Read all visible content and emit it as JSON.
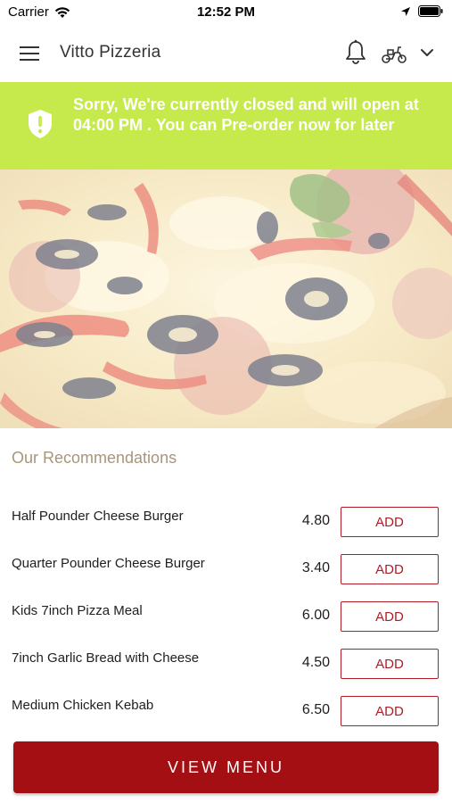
{
  "status_bar": {
    "carrier": "Carrier",
    "time": "12:52 PM"
  },
  "header": {
    "title": "Vitto Pizzeria"
  },
  "banner": {
    "message": "Sorry, We're currently closed and will open at 04:00 PM . You can Pre-order now for later",
    "color": "#c6ea4b"
  },
  "recommendations": {
    "title": "Our Recommendations",
    "add_label": "ADD",
    "items": [
      {
        "name": "Half Pounder Cheese Burger",
        "price": "4.80"
      },
      {
        "name": "Quarter Pounder Cheese Burger",
        "price": "3.40"
      },
      {
        "name": "Kids 7inch Pizza Meal",
        "price": "6.00"
      },
      {
        "name": "7inch Garlic Bread with Cheese",
        "price": "4.50"
      },
      {
        "name": "Medium Chicken Kebab",
        "price": "6.50"
      }
    ]
  },
  "footer": {
    "view_menu_label": "VIEW MENU"
  },
  "colors": {
    "accent": "#a30f12",
    "add_border": "#b01c25",
    "rec_title": "#a8957a"
  },
  "icons": [
    "wifi-icon",
    "location-arrow-icon",
    "battery-icon",
    "hamburger-menu-icon",
    "bell-icon",
    "scooter-icon",
    "chevron-down-icon",
    "shield-alert-icon"
  ]
}
